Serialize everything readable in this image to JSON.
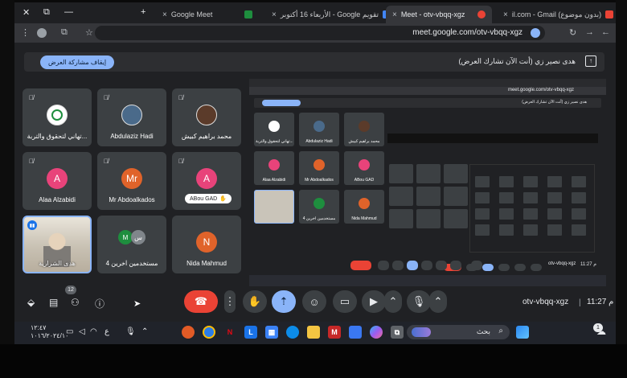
{
  "browser": {
    "tabs": [
      {
        "label": "Google Meet",
        "close": "×",
        "active": false
      },
      {
        "label": "الأربعاء 16 أكتوبر - Google تقويم",
        "close": "×",
        "active": false
      },
      {
        "label": "Meet - otv-vbqq-xgz",
        "close": "×",
        "active": true
      },
      {
        "label": "il.com - Gmail (بدون موضوع)",
        "close": "×",
        "active": false
      }
    ],
    "new_tab": "+",
    "url": "meet.google.com/otv-vbqq-xgz"
  },
  "sharing": {
    "stop_button": "إيقاف مشاركة العرض",
    "message": "هدى نصير زي (أنت الآن تشارك العرض)"
  },
  "participants": [
    {
      "name": "محمد براهيم كبيش",
      "avatar_type": "photo",
      "avatar_color": "#5b3b2a"
    },
    {
      "name": "Abdulaziz Hadi",
      "avatar_type": "photo",
      "avatar_color": "#4a6a8a"
    },
    {
      "name": "تهاني لتحقوق والتربة...",
      "avatar_type": "logo",
      "avatar_color": "#ffffff"
    },
    {
      "name": "ABou GAD",
      "avatar_letter": "A",
      "avatar_color": "#e8437a",
      "chip": true
    },
    {
      "name": "Mr Abdoalkados",
      "avatar_letter": "Mr",
      "avatar_color": "#e0632a"
    },
    {
      "name": "Alaa Alzabidi",
      "avatar_letter": "A",
      "avatar_color": "#e8437a"
    },
    {
      "name": "Nida Mahmud",
      "avatar_letter": "N",
      "avatar_color": "#e0632a"
    },
    {
      "name": "4 مستخدمين آخرين",
      "mini_left": "M",
      "mini_right": "س",
      "mini_left_color": "#1e8e3e",
      "mini_right_color": "#80868b"
    },
    {
      "name": "هدى الشرارية",
      "self": true
    }
  ],
  "nested": {
    "url": "meet.google.com/otv-vbqq-xgz",
    "message": "هدى نصير زي (أنت الآن تشارك العرض)",
    "stop": "إيقاف مشاركة العرض",
    "tiles": [
      "محمد براهيم كبيش",
      "Abdulaziz Hadi",
      "تهاني لتحقوق والتربة...",
      "ABou GAD",
      "Mr Abdoalkados",
      "Alaa Alzabidi",
      "Nida Mahmud",
      "4 مستخدمين آخرين",
      ""
    ],
    "code": "otv-vbqq-xgz",
    "time": "11:27 م"
  },
  "controls": {
    "people_count": "12",
    "meeting_code": "otv-vbqq-xgz",
    "separator": "|",
    "time": "11:27 م"
  },
  "taskbar": {
    "clock_time": "١٢:٤٧",
    "clock_date": "١٠١٦/٢٠٢٤/١٠",
    "search_placeholder": "بحث",
    "notification_count": "1",
    "lang": "ع"
  }
}
